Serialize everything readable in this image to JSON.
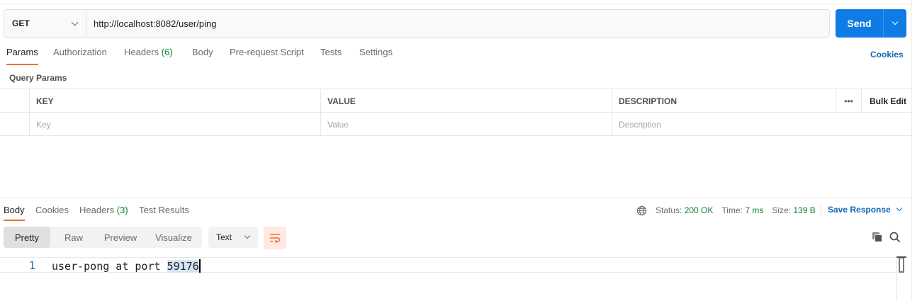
{
  "request": {
    "method": "GET",
    "url": "http://localhost:8082/user/ping",
    "send_label": "Send"
  },
  "request_tabs": [
    {
      "label": "Params",
      "active": true
    },
    {
      "label": "Authorization"
    },
    {
      "label": "Headers",
      "count": "(6)"
    },
    {
      "label": "Body"
    },
    {
      "label": "Pre-request Script"
    },
    {
      "label": "Tests"
    },
    {
      "label": "Settings"
    }
  ],
  "cookies_link": "Cookies",
  "query_params": {
    "title": "Query Params",
    "headers": [
      "KEY",
      "VALUE",
      "DESCRIPTION"
    ],
    "bulk_edit": "Bulk Edit",
    "more": "•••",
    "placeholders": [
      "Key",
      "Value",
      "Description"
    ]
  },
  "response": {
    "tabs": [
      {
        "label": "Body",
        "active": true
      },
      {
        "label": "Cookies"
      },
      {
        "label": "Headers",
        "count": "(3)"
      },
      {
        "label": "Test Results"
      }
    ],
    "status_label": "Status:",
    "status_value": "200 OK",
    "time_label": "Time:",
    "time_value": "7 ms",
    "size_label": "Size:",
    "size_value": "139 B",
    "save_response": "Save Response",
    "views": [
      "Pretty",
      "Raw",
      "Preview",
      "Visualize"
    ],
    "active_view": "Pretty",
    "format": "Text",
    "line_number": "1",
    "body_text_prefix": "user-pong at port ",
    "body_text_port": "59176"
  },
  "colors": {
    "accent_orange": "#f26b3a",
    "send_blue": "#0f7ce6",
    "link_blue": "#0f68b8",
    "status_green": "#0c7f3a"
  },
  "icons": [
    "chevron-down-icon",
    "globe-icon",
    "wrap-lines-icon",
    "copy-icon",
    "search-icon"
  ]
}
